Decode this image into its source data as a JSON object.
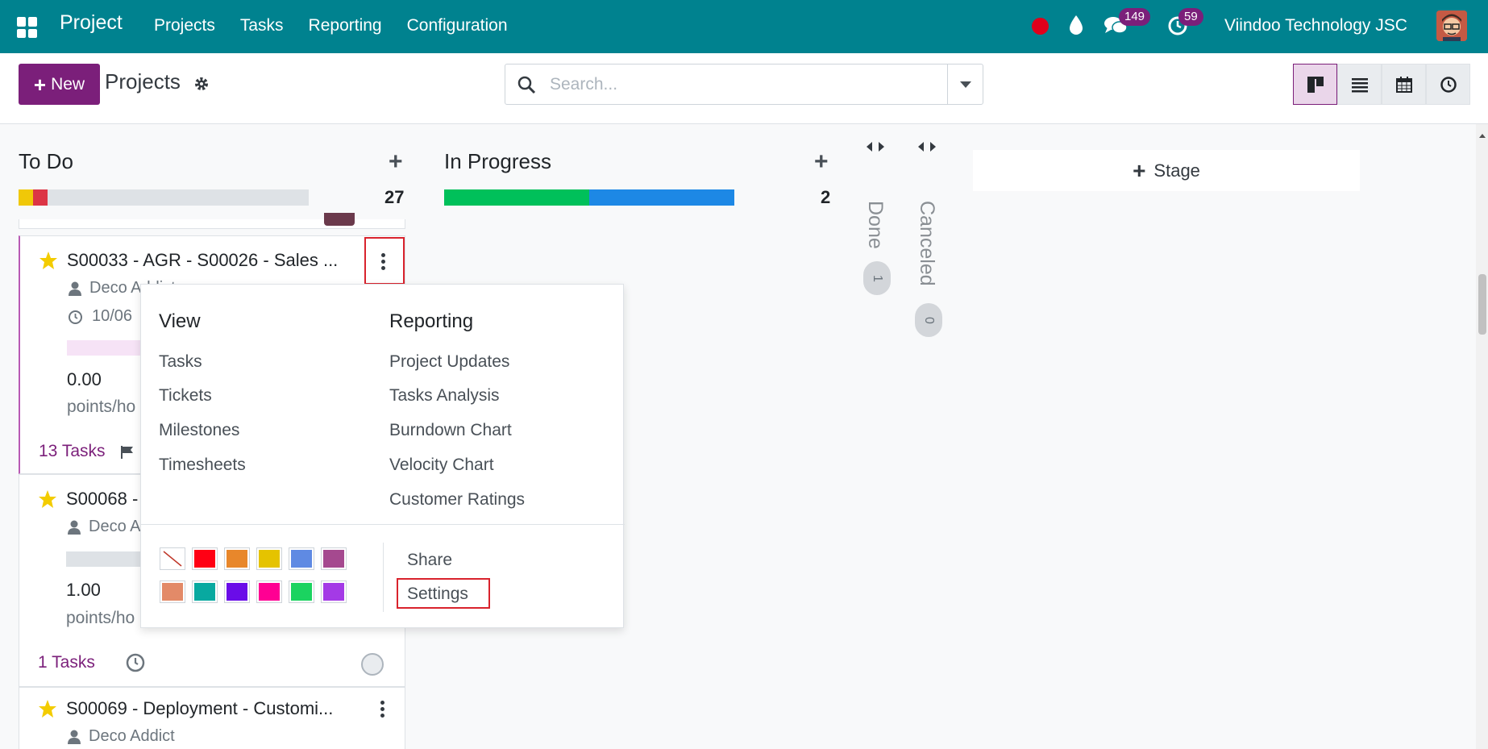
{
  "navbar": {
    "app_name": "Project",
    "menu": [
      "Projects",
      "Tasks",
      "Reporting",
      "Configuration"
    ],
    "messages_count": "149",
    "activities_count": "59",
    "company": "Viindoo Technology JSC",
    "brand_color": "#00828f"
  },
  "control": {
    "new_label": "New",
    "title": "Projects",
    "search_placeholder": "Search...",
    "views": [
      "kanban-icon",
      "list-icon",
      "calendar-icon",
      "activity-icon"
    ],
    "active_view": "kanban"
  },
  "columns": {
    "todo": {
      "title": "To Do",
      "count": "27",
      "progress": [
        {
          "color": "#f0c808",
          "fraction": 0.05
        },
        {
          "color": "#dc3545",
          "fraction": 0.05
        }
      ]
    },
    "in_progress": {
      "title": "In Progress",
      "count": "2",
      "progress": [
        {
          "color": "#00c05a",
          "fraction": 0.5
        },
        {
          "color": "#1d88e5",
          "fraction": 0.5
        }
      ]
    },
    "done": {
      "title": "Done",
      "count": "1"
    },
    "canceled": {
      "title": "Canceled",
      "count": "0"
    },
    "add_stage_label": "Stage"
  },
  "cards": [
    {
      "title": "S00033 - AGR - S00026 - Sales ...",
      "customer": "Deco Addict",
      "date": "10/06",
      "value": "0.00",
      "unit": "points/ho",
      "tasks": "13 Tasks",
      "progress_color": "#f6e3f6"
    },
    {
      "title": "S00068 -",
      "customer": "Deco A",
      "value": "1.00",
      "unit": "points/ho",
      "tasks": "1 Tasks",
      "progress_color": "#dee2e6"
    },
    {
      "title": "S00069 - Deployment - Customi...",
      "customer": "Deco Addict"
    }
  ],
  "dropdown": {
    "view_heading": "View",
    "view_items": [
      "Tasks",
      "Tickets",
      "Milestones",
      "Timesheets"
    ],
    "reporting_heading": "Reporting",
    "reporting_items": [
      "Project Updates",
      "Tasks Analysis",
      "Burndown Chart",
      "Velocity Chart",
      "Customer Ratings"
    ],
    "colors": [
      "none",
      "#ff0014",
      "#e8872b",
      "#e5c300",
      "#5f8ae3",
      "#a5498f",
      "#e38a68",
      "#08a9a0",
      "#6a0ce8",
      "#ff0093",
      "#1bd360",
      "#a43ae6"
    ],
    "share_label": "Share",
    "settings_label": "Settings"
  }
}
